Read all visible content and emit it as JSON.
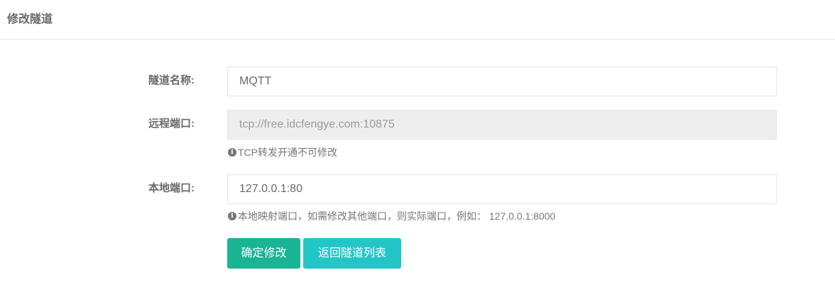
{
  "header": {
    "title": "修改隧道"
  },
  "form": {
    "tunnel_name": {
      "label": "隧道名称:",
      "value": "MQTT"
    },
    "remote_port": {
      "label": "远程端口:",
      "value": "tcp://free.idcfengye.com:10875",
      "help": "TCP转发开通不可修改"
    },
    "local_port": {
      "label": "本地端口:",
      "value": "127.0.0.1:80",
      "help": "本地映射端口，如需修改其他端口，则实际端口，例如： 127.0.0.1:8000"
    }
  },
  "buttons": {
    "confirm": "确定修改",
    "back": "返回隧道列表"
  },
  "icons": {
    "help": "info-circle-icon"
  },
  "colors": {
    "primary": "#1ab394",
    "info": "#23c6c8"
  }
}
